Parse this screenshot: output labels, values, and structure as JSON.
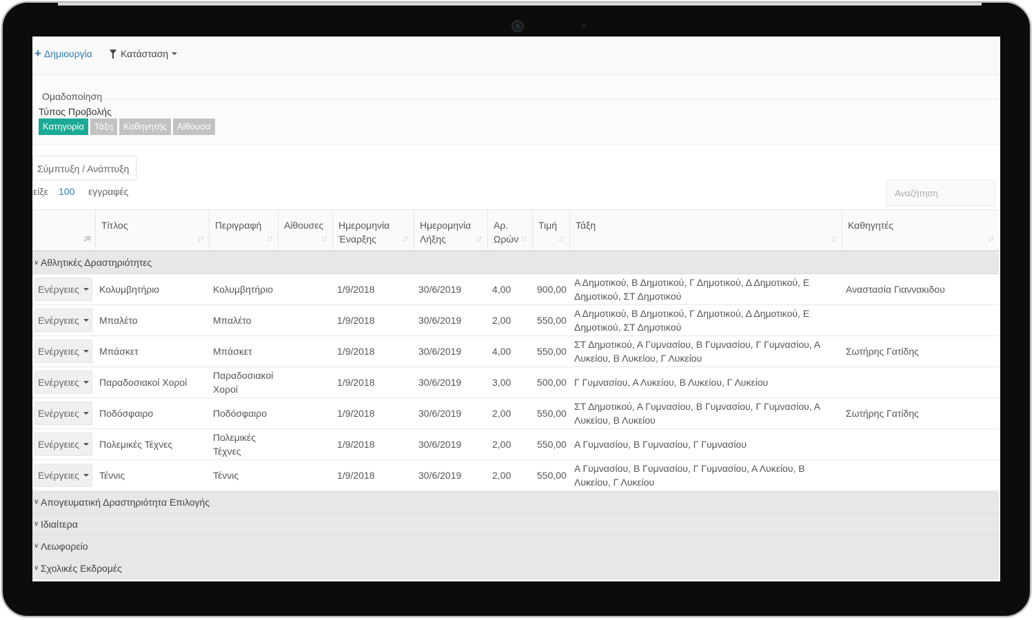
{
  "toolbar": {
    "create_label": "Δημιουργία",
    "status_label": "Κατάσταση"
  },
  "grouping": {
    "title": "Ομαδοποίηση",
    "view_type_label": "Τύπος Προβολής",
    "buttons": [
      "Κατηγορία",
      "Τάξη",
      "Καθηγητής",
      "Αίθουσα"
    ],
    "active_button": "Κατηγορία"
  },
  "collapse_label": "Σύμπτυξη / Ανάπτυξη",
  "paging": {
    "prefix": "ιείξε",
    "count": "100",
    "suffix": "εγγραφές"
  },
  "search": {
    "placeholder": "Αναζήτηση"
  },
  "columns": {
    "title": "Τίτλος",
    "description": "Περιγραφή",
    "rooms": "Αίθουσες",
    "start_date": "Ημερομηνία Έναρξης",
    "end_date": "Ημερομηνία Λήξης",
    "hours": "Αρ. Ωρών",
    "price": "Τιμή",
    "class": "Τάξη",
    "teachers": "Καθηγητές"
  },
  "actions_label": "Ενέργειες",
  "groups": [
    {
      "name": "Αθλητικές Δραστηριότητες",
      "rows": [
        {
          "title": "Κολυμβητήριο",
          "description": "Κολυμβητήριο",
          "rooms": "",
          "start": "1/9/2018",
          "end": "30/6/2019",
          "hours": "4,00",
          "price": "900,00",
          "class": "Α Δημοτικού, Β Δημοτικού, Γ Δημοτικού, Δ Δημοτικού, Ε Δημοτικού, ΣΤ Δημοτικού",
          "teachers": "Αναστασία Γιαννακιδου"
        },
        {
          "title": "Μπαλέτο",
          "description": "Μπαλέτο",
          "rooms": "",
          "start": "1/9/2018",
          "end": "30/6/2019",
          "hours": "2,00",
          "price": "550,00",
          "class": "Α Δημοτικού, Β Δημοτικού, Γ Δημοτικού, Δ Δημοτικού, Ε Δημοτικού, ΣΤ Δημοτικού",
          "teachers": ""
        },
        {
          "title": "Μπάσκετ",
          "description": "Μπάσκετ",
          "rooms": "",
          "start": "1/9/2018",
          "end": "30/6/2019",
          "hours": "4,00",
          "price": "550,00",
          "class": "ΣΤ Δημοτικού, Α Γυμνασίου, Β Γυμνασίου, Γ Γυμνασίου, Α Λυκείου, Β Λυκείου, Γ Λυκείου",
          "teachers": "Σωτήρης Γατίδης"
        },
        {
          "title": "Παραδοσιακοί Χοροί",
          "description": "Παραδοσιακοί Χοροί",
          "rooms": "",
          "start": "1/9/2018",
          "end": "30/6/2019",
          "hours": "3,00",
          "price": "500,00",
          "class": "Γ Γυμνασίου, Α Λυκείου, Β Λυκείου, Γ Λυκείου",
          "teachers": ""
        },
        {
          "title": "Ποδόσφαιρο",
          "description": "Ποδόσφαιρο",
          "rooms": "",
          "start": "1/9/2018",
          "end": "30/6/2019",
          "hours": "2,00",
          "price": "550,00",
          "class": "ΣΤ Δημοτικού, Α Γυμνασίου, Β Γυμνασίου, Γ Γυμνασίου, Α Λυκείου, Β Λυκείου",
          "teachers": "Σωτήρης Γατίδης"
        },
        {
          "title": "Πολεμικές Τέχνες",
          "description": "Πολεμικές Τέχνες",
          "rooms": "",
          "start": "1/9/2018",
          "end": "30/6/2019",
          "hours": "2,00",
          "price": "550,00",
          "class": "Α Γυμνασίου, Β Γυμνασίου, Γ Γυμνασίου",
          "teachers": ""
        },
        {
          "title": "Τέννις",
          "description": "Τέννις",
          "rooms": "",
          "start": "1/9/2018",
          "end": "30/6/2019",
          "hours": "2,00",
          "price": "550,00",
          "class": "Α Γυμνασίου, Β Γυμνασίου, Γ Γυμνασίου, Α Λυκείου, Β Λυκείου, Γ Λυκείου",
          "teachers": ""
        }
      ]
    },
    {
      "name": "Απογευματική Δραστηριότητα Επιλογής",
      "rows": []
    },
    {
      "name": "Ιδιαίτερα",
      "rows": []
    },
    {
      "name": "Λεωφορείο",
      "rows": []
    },
    {
      "name": "Σχολικές Εκδρομές",
      "rows": []
    }
  ]
}
